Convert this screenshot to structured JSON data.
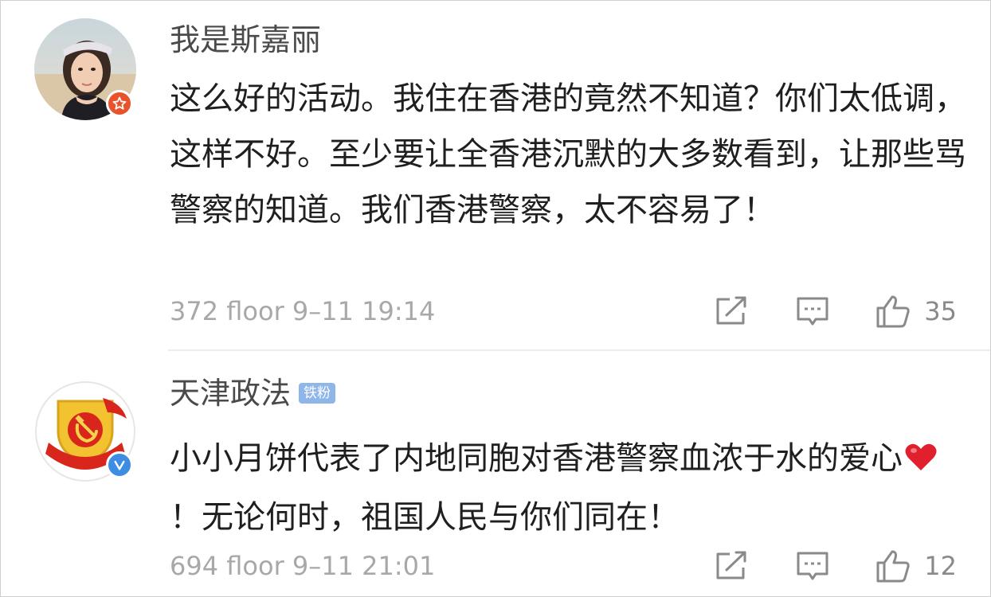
{
  "comments": [
    {
      "username": "我是斯嘉丽",
      "text": "这么好的活动。我住在香港的竟然不知道？你们太低调，这样不好。至少要让全香港沉默的大多数看到，让那些骂警察的知道。我们香港警察，太不容易了！",
      "meta": "372 floor 9–11 19:14",
      "likes": "35"
    },
    {
      "username": "天津政法",
      "fan_tag": "铁粉",
      "text_before_heart": "小小月饼代表了内地同胞对香港警察血浓于水的爱心",
      "text_after_heart": "！无论何时，祖国人民与你们同在！",
      "meta": "694 floor 9–11 21:01",
      "likes": "12"
    }
  ],
  "colors": {
    "badge_star": "#e8532b",
    "badge_verified": "#3d8de3",
    "fan_tag": "#8fb6e8",
    "heart": "#e0212d"
  },
  "icons": [
    "share-icon",
    "comment-icon",
    "like-icon",
    "star-badge-icon",
    "verified-badge-icon",
    "heart-emoji-icon"
  ]
}
